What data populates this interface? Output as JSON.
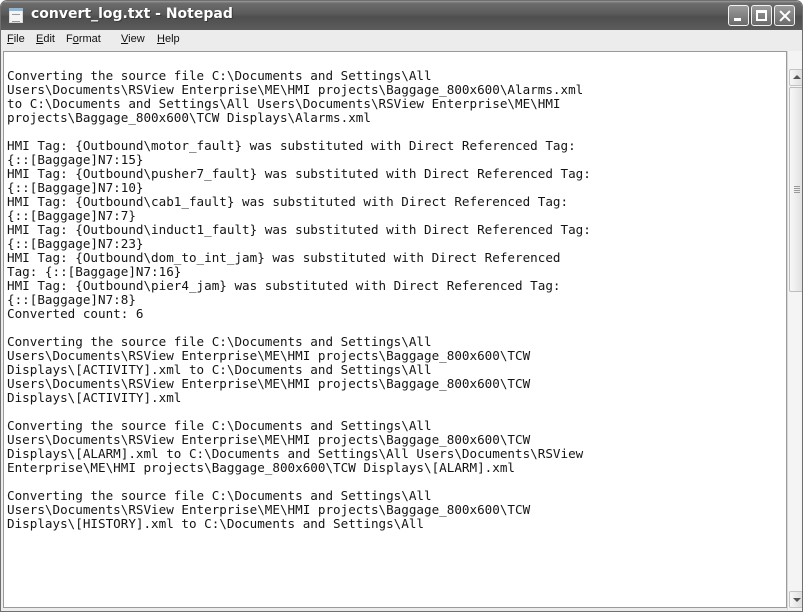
{
  "window": {
    "title": "convert_log.txt - Notepad",
    "icon": "notepad-icon"
  },
  "menu": {
    "file": {
      "underlined": "F",
      "rest": "ile"
    },
    "edit": {
      "underlined": "E",
      "rest": "dit"
    },
    "format": {
      "before": "F",
      "underlined": "o",
      "rest": "rmat"
    },
    "view": {
      "underlined": "V",
      "rest": "iew"
    },
    "help": {
      "underlined": "H",
      "rest": "elp"
    }
  },
  "editor": {
    "lines": [
      "Converting the source file C:\\Documents and Settings\\All",
      "Users\\Documents\\RSView Enterprise\\ME\\HMI projects\\Baggage_800x600\\Alarms.xml",
      "to C:\\Documents and Settings\\All Users\\Documents\\RSView Enterprise\\ME\\HMI",
      "projects\\Baggage_800x600\\TCW Displays\\Alarms.xml",
      "",
      "HMI Tag: {Outbound\\motor_fault} was substituted with Direct Referenced Tag:",
      "{::[Baggage]N7:15}",
      "HMI Tag: {Outbound\\pusher7_fault} was substituted with Direct Referenced Tag:",
      "{::[Baggage]N7:10}",
      "HMI Tag: {Outbound\\cab1_fault} was substituted with Direct Referenced Tag:",
      "{::[Baggage]N7:7}",
      "HMI Tag: {Outbound\\induct1_fault} was substituted with Direct Referenced Tag:",
      "{::[Baggage]N7:23}",
      "HMI Tag: {Outbound\\dom_to_int_jam} was substituted with Direct Referenced",
      "Tag: {::[Baggage]N7:16}",
      "HMI Tag: {Outbound\\pier4_jam} was substituted with Direct Referenced Tag:",
      "{::[Baggage]N7:8}",
      "Converted count: 6",
      "",
      "Converting the source file C:\\Documents and Settings\\All",
      "Users\\Documents\\RSView Enterprise\\ME\\HMI projects\\Baggage_800x600\\TCW",
      "Displays\\[ACTIVITY].xml to C:\\Documents and Settings\\All",
      "Users\\Documents\\RSView Enterprise\\ME\\HMI projects\\Baggage_800x600\\TCW",
      "Displays\\[ACTIVITY].xml",
      "",
      "Converting the source file C:\\Documents and Settings\\All",
      "Users\\Documents\\RSView Enterprise\\ME\\HMI projects\\Baggage_800x600\\TCW",
      "Displays\\[ALARM].xml to C:\\Documents and Settings\\All Users\\Documents\\RSView",
      "Enterprise\\ME\\HMI projects\\Baggage_800x600\\TCW Displays\\[ALARM].xml",
      "",
      "Converting the source file C:\\Documents and Settings\\All",
      "Users\\Documents\\RSView Enterprise\\ME\\HMI projects\\Baggage_800x600\\TCW",
      "Displays\\[HISTORY].xml to C:\\Documents and Settings\\All"
    ]
  },
  "colors": {
    "titlebar": "#5a5a5a",
    "title_text": "#ffffff",
    "editor_bg": "#ffffff",
    "text": "#141414"
  }
}
